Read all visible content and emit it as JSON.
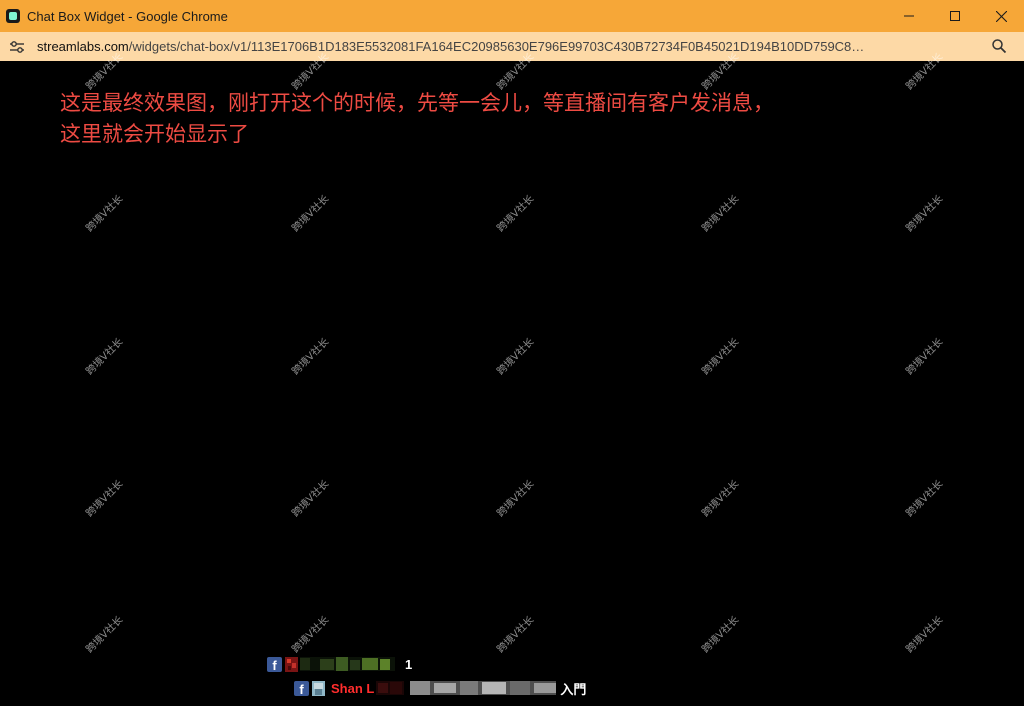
{
  "window": {
    "title": "Chat Box Widget - Google Chrome",
    "accent_color": "#f6a738",
    "address_bar_color": "#fdd9a6"
  },
  "address": {
    "host": "streamlabs.com",
    "path": "/widgets/chat-box/v1/113E1706B1D183E5532081FA164EC20985630E796E99703C430B72734F0B45021D194B10DD759C8…"
  },
  "annotation": {
    "text_line1": "这是最终效果图，刚打开这个的时候，先等一会儿，等直播间有客户发消息，",
    "text_line2": "这里就会开始显示了",
    "color": "#ee4b43"
  },
  "watermark": {
    "text": "跨境V社长"
  },
  "chat": {
    "messages": [
      {
        "platform_icon": "facebook-icon",
        "name": "",
        "text": "1"
      },
      {
        "platform_icon": "facebook-icon",
        "name": "Shan L",
        "text": "入門"
      }
    ],
    "name_color": "#ff2d2d"
  }
}
